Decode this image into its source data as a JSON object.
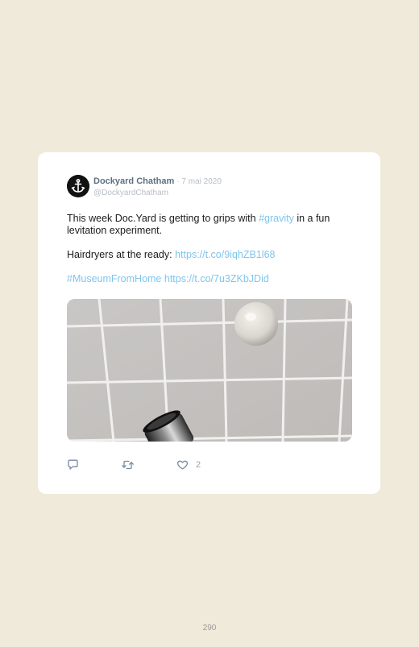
{
  "tweet": {
    "author_name": "Dockyard Chatham",
    "date": "· 7 mai 2020",
    "handle": "@DockyardChatham",
    "text": {
      "p1_before": "This week Doc.Yard is getting to grips with ",
      "p1_hashtag": "#gravity",
      "p1_after": " in a fun levitation experiment.",
      "p2_before": "Hairdryers at the ready: ",
      "p2_link": "https://t.co/9iqhZB1l68",
      "p3_hashtag": "#MuseumFromHome",
      "p3_link": "https://t.co/7u3ZKbJDid"
    },
    "media_description": "Ball levitating above a hairdryer against grey tiles",
    "actions": {
      "reply_icon": "reply-icon",
      "retweet_icon": "retweet-icon",
      "like_icon": "heart-icon",
      "like_count": "2"
    }
  },
  "page": {
    "number": "290"
  },
  "colors": {
    "background": "#f0eadb",
    "card": "#ffffff",
    "link": "#7fc5ec",
    "name": "#5f6f80",
    "muted": "#b7bec6"
  }
}
